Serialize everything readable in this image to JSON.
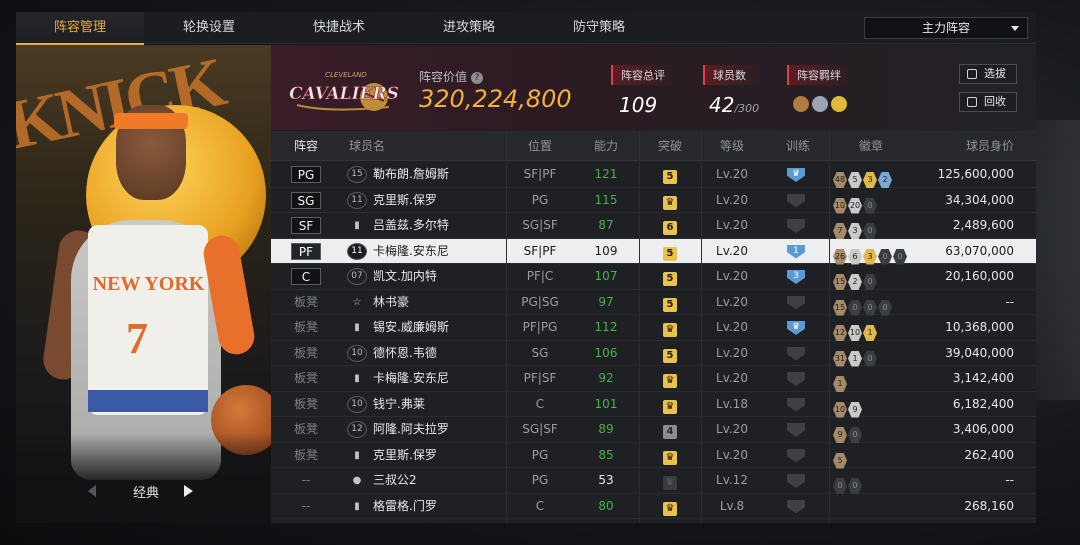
{
  "tabs": [
    "阵容管理",
    "轮换设置",
    "快捷战术",
    "进攻策略",
    "防守策略"
  ],
  "lineup_select": "主力阵容",
  "player_panel": {
    "label": "经典",
    "jersey_text": "NEW YORK",
    "jersey_number": "7"
  },
  "team": {
    "logo_text": "CAVALIERS",
    "logo_subtext": "CLEVELAND",
    "value_label": "阵容价值",
    "value": "320,224,800",
    "rating_label": "阵容总评",
    "rating": "109",
    "roster_label": "球员数",
    "roster_count": "42",
    "roster_max": "/300",
    "bond_label": "阵容羁绊"
  },
  "buttons": {
    "select": "选拔",
    "recall": "回收"
  },
  "columns": {
    "slot": "阵容",
    "name": "球员名",
    "pos": "位置",
    "ability": "能力",
    "breakthrough": "突破",
    "level": "等级",
    "training": "训练",
    "badges": "徽章",
    "price": "球员身价"
  },
  "colors": {
    "accent": "#e9a94a",
    "ability_green": "#4ab04a",
    "gold": "#e8c24a",
    "training_blue": "#5b9bd5"
  },
  "rows": [
    {
      "slot": "PG",
      "num": "15",
      "name": "勒布朗.詹姆斯",
      "pos": "SF|PF",
      "ability": "121",
      "brk": "5",
      "lv": "Lv.20",
      "train": "crown",
      "badges": [
        "48",
        "5",
        "3",
        "2"
      ],
      "price": "125,600,000"
    },
    {
      "slot": "SG",
      "num": "11",
      "name": "克里斯.保罗",
      "pos": "PG",
      "ability": "115",
      "brk": "crown",
      "lv": "Lv.20",
      "train": "none",
      "badges": [
        "10",
        "20",
        "0"
      ],
      "price": "34,304,000"
    },
    {
      "slot": "SF",
      "num": "icon",
      "name": "吕盖兹.多尔特",
      "pos": "SG|SF",
      "ability": "87",
      "brk": "6",
      "lv": "Lv.20",
      "train": "none",
      "badges": [
        "7",
        "3",
        "0"
      ],
      "price": "2,489,600"
    },
    {
      "slot": "PF",
      "num": "11",
      "name": "卡梅隆.安东尼",
      "pos": "SF|PF",
      "ability": "109",
      "brk": "5",
      "lv": "Lv.20",
      "train": "1",
      "badges": [
        "26",
        "6",
        "3",
        "0",
        "0"
      ],
      "price": "63,070,000",
      "selected": true
    },
    {
      "slot": "C",
      "num": "07",
      "name": "凯文.加内特",
      "pos": "PF|C",
      "ability": "107",
      "brk": "5",
      "lv": "Lv.20",
      "train": "3",
      "badges": [
        "15",
        "2",
        "0"
      ],
      "price": "20,160,000"
    },
    {
      "slot": "板凳",
      "num": "star",
      "name": "林书豪",
      "pos": "PG|SG",
      "ability": "97",
      "brk": "5",
      "lv": "Lv.20",
      "train": "none",
      "badges": [
        "15",
        "0",
        "0",
        "0"
      ],
      "price": "--"
    },
    {
      "slot": "板凳",
      "num": "icon",
      "name": "锡安.威廉姆斯",
      "pos": "PF|PG",
      "ability": "112",
      "brk": "crown",
      "lv": "Lv.20",
      "train": "crown",
      "badges": [
        "12",
        "10",
        "1"
      ],
      "price": "10,368,000"
    },
    {
      "slot": "板凳",
      "num": "10",
      "name": "德怀恩.韦德",
      "pos": "SG",
      "ability": "106",
      "brk": "5",
      "lv": "Lv.20",
      "train": "none",
      "badges": [
        "31",
        "1",
        "0"
      ],
      "price": "39,040,000"
    },
    {
      "slot": "板凳",
      "num": "icon",
      "name": "卡梅隆.安东尼",
      "pos": "PF|SF",
      "ability": "92",
      "brk": "crown",
      "lv": "Lv.20",
      "train": "none",
      "badges": [
        "1"
      ],
      "price": "3,142,400"
    },
    {
      "slot": "板凳",
      "num": "10",
      "name": "钱宁.弗莱",
      "pos": "C",
      "ability": "101",
      "brk": "crown",
      "lv": "Lv.18",
      "train": "none",
      "badges": [
        "10",
        "9"
      ],
      "price": "6,182,400"
    },
    {
      "slot": "板凳",
      "num": "12",
      "name": "阿隆.阿夫拉罗",
      "pos": "SG|SF",
      "ability": "89",
      "brk": "4",
      "lv": "Lv.20",
      "train": "none",
      "badges": [
        "9",
        "0"
      ],
      "price": "3,406,000"
    },
    {
      "slot": "板凳",
      "num": "icon",
      "name": "克里斯.保罗",
      "pos": "PG",
      "ability": "85",
      "brk": "crown",
      "lv": "Lv.20",
      "train": "none",
      "badges": [
        "5"
      ],
      "price": "262,400"
    },
    {
      "slot": "--",
      "num": "person",
      "name": "三叔公2",
      "pos": "PG",
      "ability": "53",
      "brk": "dark",
      "lv": "Lv.12",
      "train": "none",
      "badges": [
        "0",
        "0"
      ],
      "price": "--",
      "ability_white": true
    },
    {
      "slot": "--",
      "num": "icon",
      "name": "格雷格.门罗",
      "pos": "C",
      "ability": "80",
      "brk": "crown",
      "lv": "Lv.8",
      "train": "none",
      "badges": [],
      "price": "268,160"
    }
  ]
}
